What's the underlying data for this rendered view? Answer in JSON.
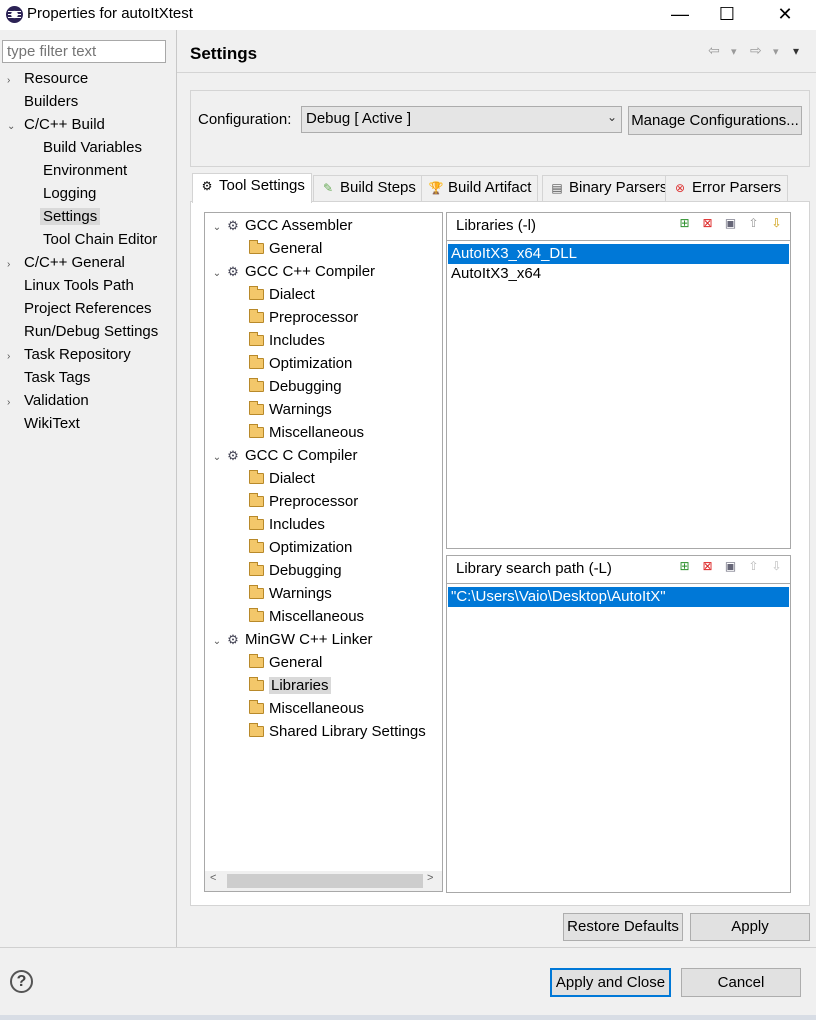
{
  "window": {
    "title": "Properties for autoItXtest",
    "minimize": "—",
    "maximize": "☐",
    "close": "✕"
  },
  "filter": {
    "placeholder": "type filter text"
  },
  "nav": [
    {
      "label": "Resource",
      "arrow": "›",
      "indent": 0
    },
    {
      "label": "Builders",
      "arrow": "",
      "indent": 0
    },
    {
      "label": "C/C++ Build",
      "arrow": "⌄",
      "indent": 0
    },
    {
      "label": "Build Variables",
      "arrow": "",
      "indent": 1
    },
    {
      "label": "Environment",
      "arrow": "",
      "indent": 1
    },
    {
      "label": "Logging",
      "arrow": "",
      "indent": 1
    },
    {
      "label": "Settings",
      "arrow": "",
      "indent": 1,
      "selected": true
    },
    {
      "label": "Tool Chain Editor",
      "arrow": "",
      "indent": 1
    },
    {
      "label": "C/C++ General",
      "arrow": "›",
      "indent": 0
    },
    {
      "label": "Linux Tools Path",
      "arrow": "",
      "indent": 0
    },
    {
      "label": "Project References",
      "arrow": "",
      "indent": 0
    },
    {
      "label": "Run/Debug Settings",
      "arrow": "",
      "indent": 0
    },
    {
      "label": "Task Repository",
      "arrow": "›",
      "indent": 0
    },
    {
      "label": "Task Tags",
      "arrow": "",
      "indent": 0
    },
    {
      "label": "Validation",
      "arrow": "›",
      "indent": 0
    },
    {
      "label": "WikiText",
      "arrow": "",
      "indent": 0
    }
  ],
  "header": {
    "title": "Settings",
    "back_icon": "⇦",
    "forward_icon": "⇨",
    "menu_icon": "▾"
  },
  "config": {
    "label": "Configuration:",
    "value": "Debug  [ Active ]",
    "caret": "⌄",
    "manage_label": "Manage Configurations..."
  },
  "tabs": [
    {
      "label": "Tool Settings",
      "icon": "⚙",
      "active": true
    },
    {
      "label": "Build Steps",
      "icon": "✎"
    },
    {
      "label": "Build Artifact",
      "icon": "🏆"
    },
    {
      "label": "Binary Parsers",
      "icon": "▤"
    },
    {
      "label": "Error Parsers",
      "icon": "⊗"
    }
  ],
  "tree": [
    {
      "label": "GCC Assembler",
      "type": "tool",
      "expanded": true
    },
    {
      "label": "General",
      "type": "folder"
    },
    {
      "label": "GCC C++ Compiler",
      "type": "tool",
      "expanded": true
    },
    {
      "label": "Dialect",
      "type": "folder"
    },
    {
      "label": "Preprocessor",
      "type": "folder"
    },
    {
      "label": "Includes",
      "type": "folder"
    },
    {
      "label": "Optimization",
      "type": "folder"
    },
    {
      "label": "Debugging",
      "type": "folder"
    },
    {
      "label": "Warnings",
      "type": "folder"
    },
    {
      "label": "Miscellaneous",
      "type": "folder"
    },
    {
      "label": "GCC C Compiler",
      "type": "tool",
      "expanded": true
    },
    {
      "label": "Dialect",
      "type": "folder"
    },
    {
      "label": "Preprocessor",
      "type": "folder"
    },
    {
      "label": "Includes",
      "type": "folder"
    },
    {
      "label": "Optimization",
      "type": "folder"
    },
    {
      "label": "Debugging",
      "type": "folder"
    },
    {
      "label": "Warnings",
      "type": "folder"
    },
    {
      "label": "Miscellaneous",
      "type": "folder"
    },
    {
      "label": "MinGW C++ Linker",
      "type": "tool",
      "expanded": true
    },
    {
      "label": "General",
      "type": "folder"
    },
    {
      "label": "Libraries",
      "type": "folder",
      "selected": true
    },
    {
      "label": "Miscellaneous",
      "type": "folder"
    },
    {
      "label": "Shared Library Settings",
      "type": "folder"
    }
  ],
  "libraries": {
    "title": "Libraries (-l)",
    "tools": [
      "add-icon",
      "delete-icon",
      "edit-icon",
      "move-up-icon",
      "move-down-icon"
    ],
    "items": [
      "AutoItX3_x64_DLL",
      "AutoItX3_x64"
    ],
    "selected_index": 0
  },
  "search_path": {
    "title": "Library search path (-L)",
    "tools": [
      "add-icon",
      "delete-icon",
      "edit-icon",
      "move-up-icon",
      "move-down-icon"
    ],
    "items": [
      "\"C:\\Users\\Vaio\\Desktop\\AutoItX\""
    ],
    "selected_index": 0
  },
  "buttons": {
    "restore_defaults": "Restore Defaults",
    "apply": "Apply",
    "apply_and_close": "Apply and Close",
    "cancel": "Cancel",
    "help": "?"
  },
  "colors": {
    "selection": "#0078d7",
    "accent_border": "#0078d7"
  }
}
